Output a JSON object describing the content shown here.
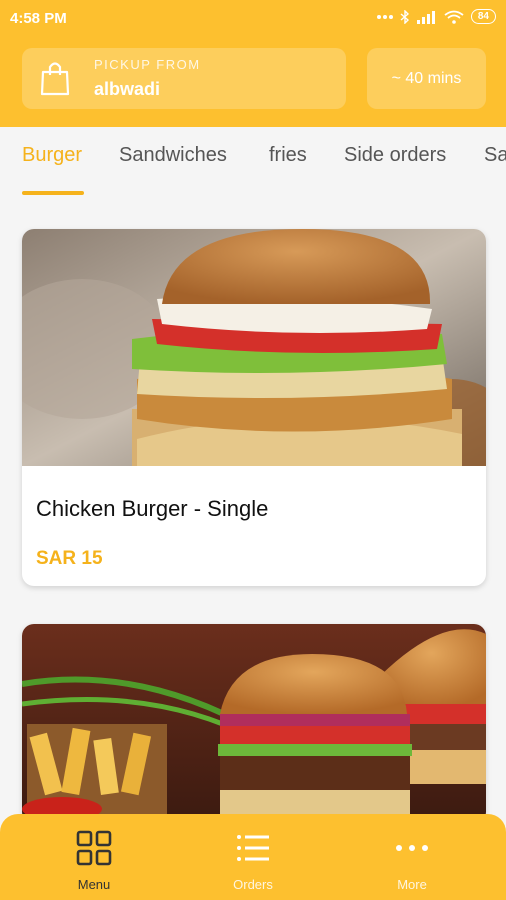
{
  "status_bar": {
    "time": "4:58 PM",
    "battery": "84"
  },
  "pickup": {
    "label": "PICKUP FROM",
    "value": "albwadi",
    "icon": "shopping-bag-icon"
  },
  "eta": "~ 40 mins",
  "tabs": [
    {
      "label": "Burger",
      "active": true
    },
    {
      "label": "Sandwiches",
      "active": false
    },
    {
      "label": "fries",
      "active": false
    },
    {
      "label": "Side orders",
      "active": false
    },
    {
      "label": "Sa",
      "active": false
    }
  ],
  "menu_items": [
    {
      "name": "Chicken Burger - Single",
      "price": "SAR 15"
    }
  ],
  "bottom_nav": [
    {
      "label": "Menu",
      "icon": "grid-icon",
      "active": true
    },
    {
      "label": "Orders",
      "icon": "list-icon",
      "active": false
    },
    {
      "label": "More",
      "icon": "more-dots-icon",
      "active": false
    }
  ],
  "colors": {
    "brand": "#FDC02F",
    "accent": "#F5B21B"
  }
}
